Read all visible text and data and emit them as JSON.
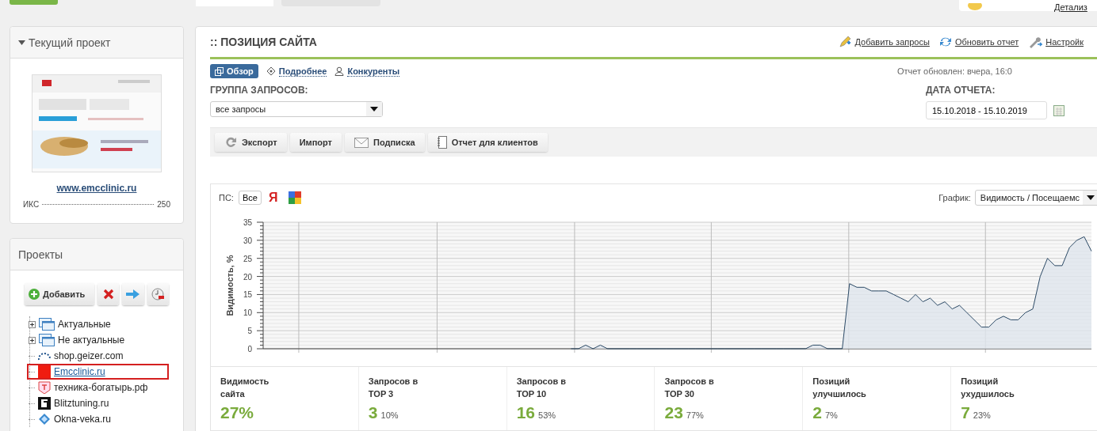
{
  "top_bar": {
    "detail_link": "Детализ"
  },
  "current_project": {
    "title": "Текущий проект",
    "expanded": true,
    "site_link": "www.emcclinic.ru",
    "metric_label": "ИКС",
    "metric_value": "250"
  },
  "projects": {
    "title": "Проекты",
    "add_button": "Добавить",
    "tree": [
      {
        "kind": "folder",
        "label": "Актуальные",
        "expanded": false,
        "selected": false
      },
      {
        "kind": "folder",
        "label": "Не актуальные",
        "expanded": false,
        "selected": false
      },
      {
        "kind": "site",
        "label": "shop.geizer.com",
        "selected": false
      },
      {
        "kind": "site",
        "label": "Emcclinic.ru",
        "selected": true
      },
      {
        "kind": "site",
        "label": "техника-богатырь.рф",
        "selected": false
      },
      {
        "kind": "site",
        "label": "Blitztuning.ru",
        "selected": false
      },
      {
        "kind": "site",
        "label": "Okna-veka.ru",
        "selected": false
      }
    ]
  },
  "site_position": {
    "title": ":: ПОЗИЦИЯ САЙТА",
    "actions": [
      "Добавить запросы",
      "Обновить отчет",
      "Настройк"
    ],
    "tabs": [
      {
        "label": "Обзор",
        "selected": true
      },
      {
        "label": "Подробнее",
        "selected": false
      },
      {
        "label": "Конкуренты",
        "selected": false
      }
    ],
    "updated": "Отчет обновлен: вчера, 16:0",
    "query_group": {
      "label": "ГРУППА ЗАПРОСОВ:",
      "value": "все запросы"
    },
    "report_date": {
      "label": "ДАТА ОТЧЕТА:",
      "value": "15.10.2018 - 15.10.2019"
    },
    "toolbar": [
      "Экспорт",
      "Импорт",
      "Подписка",
      "Отчет для клиентов"
    ],
    "search_engines": {
      "label": "ПС:",
      "options": [
        {
          "kind": "all",
          "label": "Все",
          "selected": true
        },
        {
          "kind": "yandex",
          "label": "Я",
          "selected": false
        },
        {
          "kind": "google",
          "selected": false
        }
      ]
    },
    "chart_type": {
      "label": "График:",
      "value": "Видимость / Посещаемс"
    },
    "chart_data": {
      "type": "area",
      "grid": true,
      "ylabel": "Видимость, %",
      "ylim": [
        0,
        35
      ],
      "yticks": [
        0,
        5,
        10,
        15,
        20,
        25,
        30,
        35
      ],
      "series": [
        {
          "color": "#2c4a66",
          "values": [
            null,
            null,
            null,
            null,
            null,
            null,
            null,
            null,
            null,
            null,
            null,
            null,
            null,
            null,
            null,
            null,
            null,
            null,
            null,
            null,
            null,
            null,
            null,
            null,
            null,
            null,
            null,
            null,
            null,
            null,
            null,
            null,
            null,
            null,
            null,
            null,
            null,
            null,
            null,
            null,
            null,
            null,
            0,
            0,
            1,
            0,
            1,
            0,
            0,
            0,
            0,
            0,
            0,
            0,
            0,
            0,
            0,
            0,
            0,
            0,
            0,
            0,
            0,
            0,
            0,
            0,
            0,
            0,
            0,
            0,
            0,
            0,
            0,
            0,
            0,
            1,
            1,
            0,
            0,
            0,
            18,
            17,
            17,
            16,
            16,
            16,
            15,
            14,
            13,
            15,
            13,
            14,
            12,
            13,
            11,
            12,
            10,
            8,
            6,
            6,
            8,
            9,
            8,
            8,
            10,
            11,
            20,
            25,
            23,
            23,
            28,
            30,
            31,
            27
          ]
        }
      ]
    },
    "stats": [
      {
        "label": "Видимость\nсайта",
        "value": "27%"
      },
      {
        "label": "Запросов в\nTOP 3",
        "value": "3",
        "share": "10%"
      },
      {
        "label": "Запросов в\nTOP 10",
        "value": "16",
        "share": "53%"
      },
      {
        "label": "Запросов в\nTOP 30",
        "value": "23",
        "share": "77%"
      },
      {
        "label": "Позиций\nулучшилось",
        "value": "2",
        "share": "7%"
      },
      {
        "label": "Позиций\nухудшилось",
        "value": "7",
        "share": "23%"
      }
    ]
  }
}
